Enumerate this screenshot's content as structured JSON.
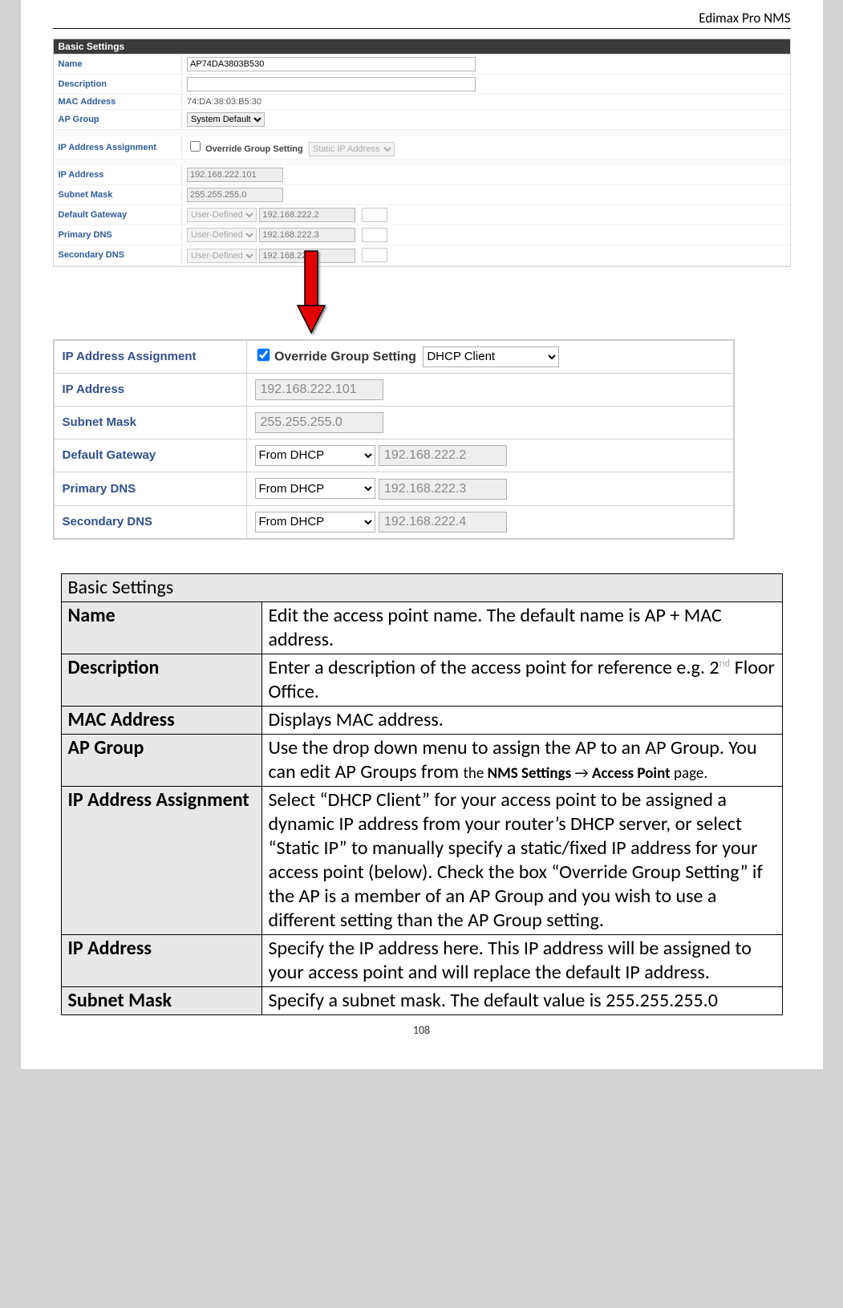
{
  "header": {
    "product": "Edimax Pro NMS"
  },
  "panel1": {
    "title": "Basic Settings",
    "rows": {
      "name": {
        "label": "Name",
        "value": "AP74DA3803B530"
      },
      "description": {
        "label": "Description",
        "value": ""
      },
      "mac": {
        "label": "MAC Address",
        "value": "74:DA:38:03:B5:30"
      },
      "apgroup": {
        "label": "AP Group",
        "value": "System Default"
      },
      "ipassign": {
        "label": "IP Address Assignment",
        "override": "Override Group Setting",
        "mode": "Static IP Address"
      },
      "ip": {
        "label": "IP Address",
        "value": "192.168.222.101"
      },
      "subnet": {
        "label": "Subnet Mask",
        "value": "255.255.255.0"
      },
      "gateway": {
        "label": "Default Gateway",
        "mode": "User-Defined",
        "value": "192.168.222.2"
      },
      "pdns": {
        "label": "Primary DNS",
        "mode": "User-Defined",
        "value": "192.168.222.3"
      },
      "sdns": {
        "label": "Secondary DNS",
        "mode": "User-Defined",
        "value": "192.168.222.4"
      }
    }
  },
  "panel2": {
    "rows": {
      "ipassign": {
        "label": "IP Address Assignment",
        "override": "Override Group Setting",
        "mode": "DHCP Client"
      },
      "ip": {
        "label": "IP Address",
        "value": "192.168.222.101"
      },
      "subnet": {
        "label": "Subnet Mask",
        "value": "255.255.255.0"
      },
      "gateway": {
        "label": "Default Gateway",
        "mode": "From DHCP",
        "value": "192.168.222.2"
      },
      "pdns": {
        "label": "Primary DNS",
        "mode": "From DHCP",
        "value": "192.168.222.3"
      },
      "sdns": {
        "label": "Secondary DNS",
        "mode": "From DHCP",
        "value": "192.168.222.4"
      }
    }
  },
  "doc": {
    "title": "Basic Settings",
    "rows": [
      {
        "k": "Name",
        "v": "Edit the access point name. The default name is AP + MAC address."
      },
      {
        "k": "Description",
        "v_html": "desc"
      },
      {
        "k": "MAC Address",
        "v": "Displays MAC address."
      },
      {
        "k": "AP Group",
        "v_html": "apgroup"
      },
      {
        "k": "IP Address Assignment",
        "v": "Select “DHCP Client” for your access point to be assigned a dynamic IP address from your router’s DHCP server, or select “Static IP” to manually specify a static/fixed IP address for your access point (below). Check the box “Override Group Setting” if the AP is a member of an AP Group and you wish to use a different setting than the AP Group setting."
      },
      {
        "k": "IP Address",
        "v": "Specify the IP address here. This IP address will be assigned to your access point and will replace the default IP address."
      },
      {
        "k": "Subnet Mask",
        "v": "Specify a subnet mask. The default value is 255.255.255.0"
      }
    ],
    "desc_parts": {
      "a": "Enter a description of the access point for reference e.g. 2",
      "sup": "nd",
      "b": " Floor Office."
    },
    "apgroup_parts": {
      "a": "Use the drop down menu to assign the AP to an AP Group. You can edit AP Groups from ",
      "b": "the ",
      "c": "NMS Settings",
      "arrow": " → ",
      "d": "Access Point",
      "e": " page."
    }
  },
  "page_number": "108"
}
